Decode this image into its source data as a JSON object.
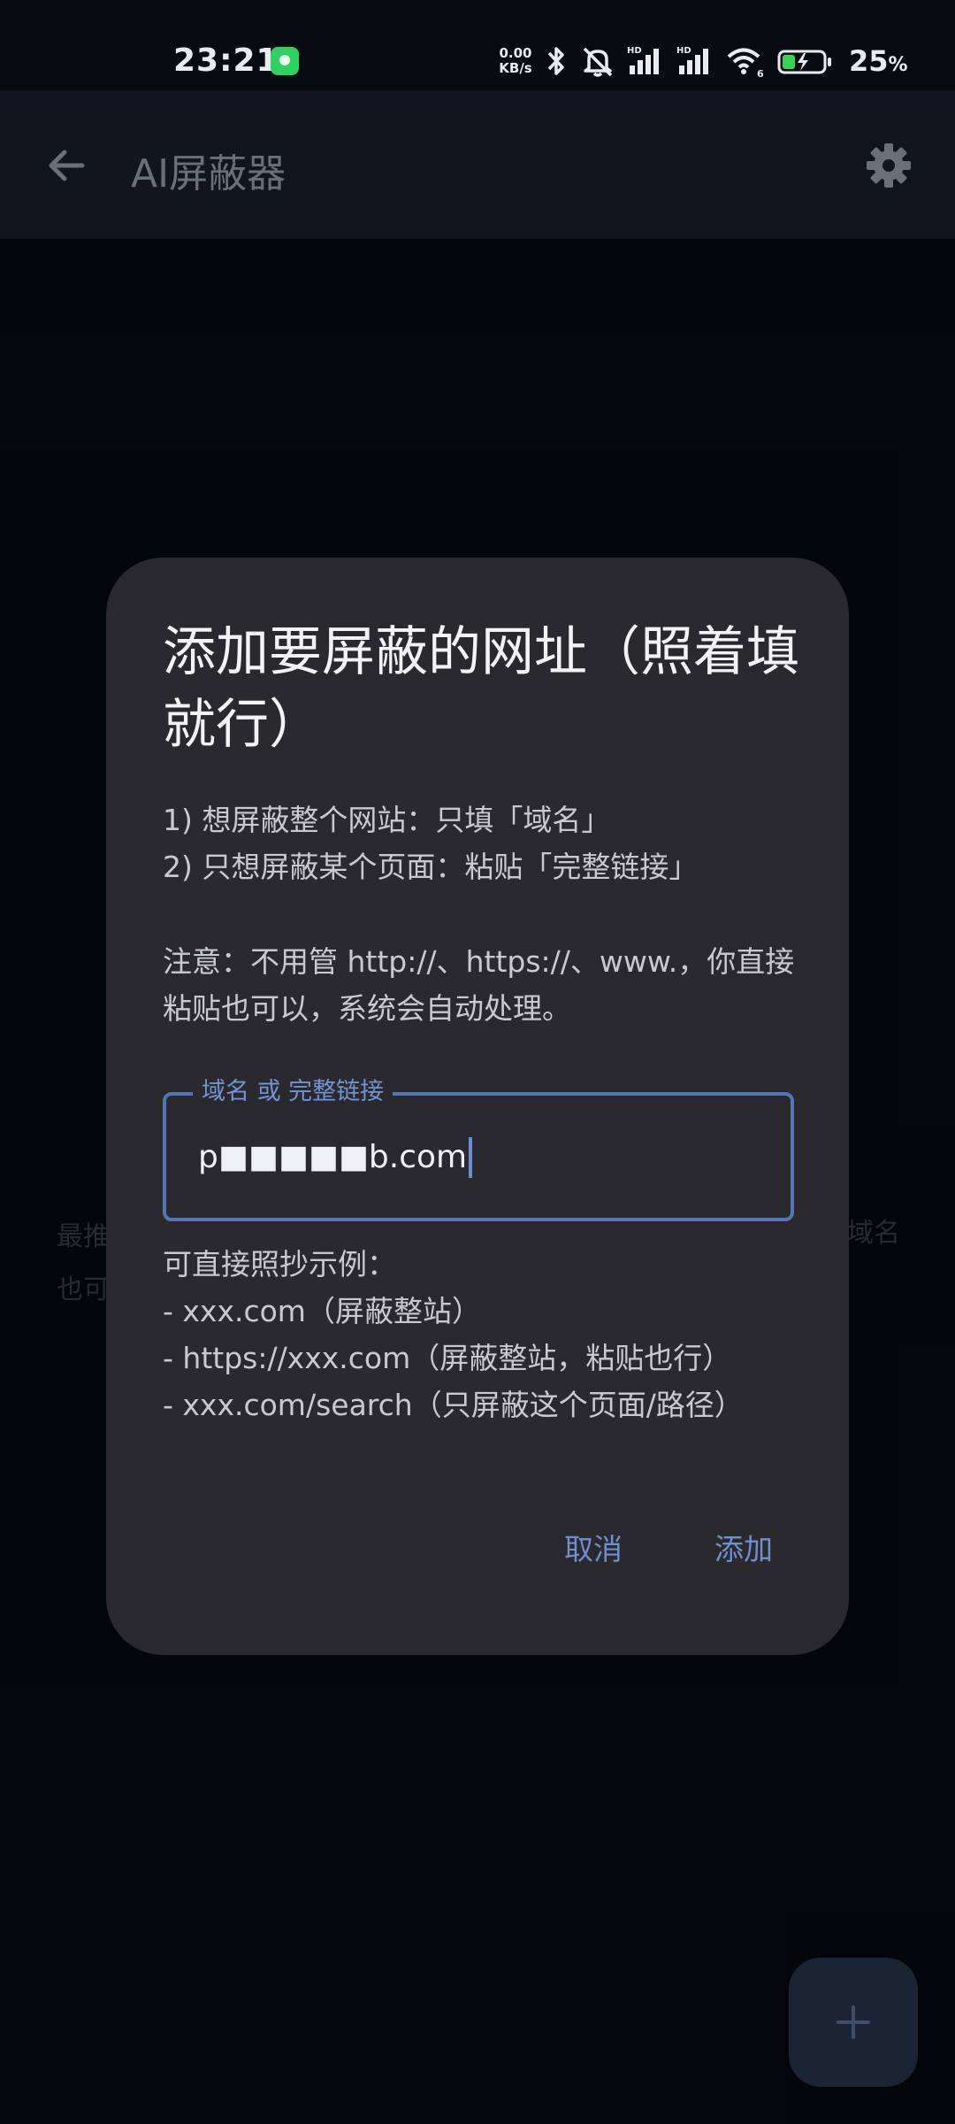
{
  "status_bar": {
    "time": "23:21",
    "net_speed_value": "0.00",
    "net_speed_unit": "KB/s",
    "battery_percent": "25",
    "battery_unit": "%",
    "signal_1_label": "HD",
    "signal_2_label": "HD",
    "wifi_label": "6",
    "icons": [
      "bluetooth-icon",
      "mute-icon",
      "signal-icon",
      "signal-icon",
      "wifi-icon",
      "battery-charging-icon"
    ]
  },
  "app_bar": {
    "title": "AI屏蔽器",
    "back_icon": "arrow-back-icon",
    "settings_icon": "gear-icon"
  },
  "background": {
    "hint_line_1_left": "最推",
    "hint_line_2_left": "也可",
    "hint_line_1_right": "域名"
  },
  "dialog": {
    "title": "添加要屏蔽的网址（照着填就行）",
    "instructions": [
      "1) 想屏蔽整个网站：只填「域名」",
      "2) 只想屏蔽某个页面：粘贴「完整链接」"
    ],
    "note": "注意：不用管 http://、https://、www.，你直接粘贴也可以，系统会自动处理。",
    "field": {
      "label": "域名 或 完整链接",
      "value": "p■■■■■b.com"
    },
    "examples_heading": "可直接照抄示例：",
    "examples": [
      "- xxx.com（屏蔽整站）",
      "- https://xxx.com（屏蔽整站，粘贴也行）",
      "- xxx.com/search（只屏蔽这个页面/路径）"
    ],
    "cancel_label": "取消",
    "add_label": "添加"
  },
  "fab": {
    "icon": "plus-icon"
  }
}
